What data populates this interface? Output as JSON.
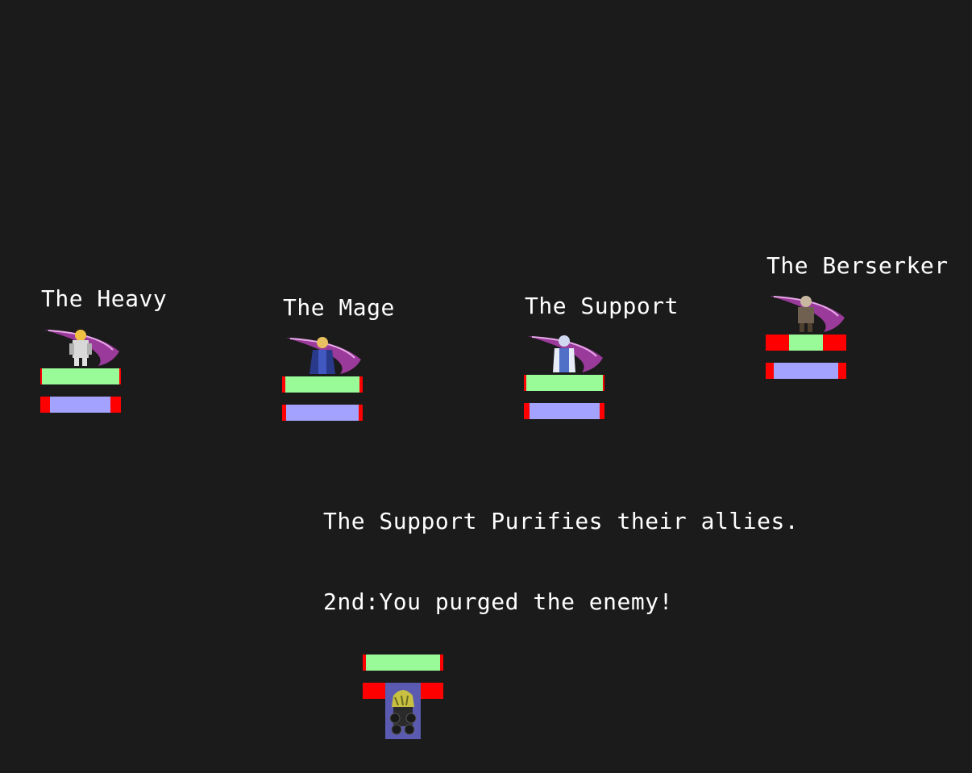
{
  "enemies": [
    {
      "name": "The Heavy",
      "hp_fraction": 0.96,
      "mp_fraction": 0.75,
      "sprite_icon": "heavy-knight-sprite",
      "effect_icon": "purple-slash-effect"
    },
    {
      "name": "The Mage",
      "hp_fraction": 0.92,
      "mp_fraction": 0.9,
      "sprite_icon": "mage-sprite",
      "effect_icon": "purple-slash-effect"
    },
    {
      "name": "The Support",
      "hp_fraction": 0.95,
      "mp_fraction": 0.87,
      "sprite_icon": "support-cleric-sprite",
      "effect_icon": "purple-slash-effect"
    },
    {
      "name": "The Berserker",
      "hp_fraction": 0.42,
      "mp_fraction": 0.8,
      "sprite_icon": "berserker-sprite",
      "effect_icon": "purple-slash-effect"
    }
  ],
  "log": {
    "line1": "The Support Purifies their allies.",
    "line2": "2nd:You purged the enemy!"
  },
  "player": {
    "hp_fraction": 0.92,
    "mp_fraction": 0.43,
    "sprite_icon": "player-blonde-hero-sprite"
  },
  "colors": {
    "background": "#1b1b1b",
    "hp_fill": "#98fb98",
    "mp_fill": "#a3a3ff",
    "bar_empty": "#ff0000",
    "effect_purple": "#b040b0"
  }
}
